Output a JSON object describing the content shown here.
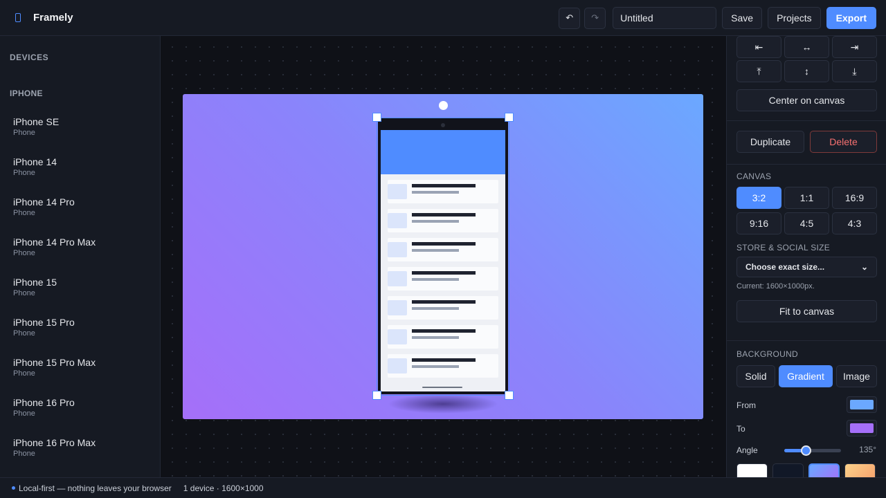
{
  "app": {
    "name": "Framely"
  },
  "toolbar": {
    "undo_icon": "↶",
    "redo_icon": "↷",
    "title_value": "Untitled",
    "save_label": "Save",
    "projects_label": "Projects",
    "export_label": "Export"
  },
  "sidebar": {
    "heading": "DEVICES",
    "group": "IPHONE",
    "devices": [
      {
        "name": "iPhone SE",
        "type": "Phone"
      },
      {
        "name": "iPhone 14",
        "type": "Phone"
      },
      {
        "name": "iPhone 14 Pro",
        "type": "Phone"
      },
      {
        "name": "iPhone 14 Pro Max",
        "type": "Phone"
      },
      {
        "name": "iPhone 15",
        "type": "Phone"
      },
      {
        "name": "iPhone 15 Pro",
        "type": "Phone"
      },
      {
        "name": "iPhone 15 Pro Max",
        "type": "Phone"
      },
      {
        "name": "iPhone 16 Pro",
        "type": "Phone"
      },
      {
        "name": "iPhone 16 Pro Max",
        "type": "Phone"
      }
    ]
  },
  "panel": {
    "align_row1": [
      "⇤",
      "↔",
      "⇥"
    ],
    "align_row2": [
      "⤒",
      "↕",
      "⤓"
    ],
    "center_label": "Center on canvas",
    "duplicate_label": "Duplicate",
    "delete_label": "Delete",
    "canvas_label": "CANVAS",
    "ratios": [
      "3:2",
      "1:1",
      "16:9",
      "9:16",
      "4:5",
      "4:3"
    ],
    "active_ratio": "3:2",
    "store_label": "STORE & SOCIAL SIZE",
    "size_select": "Choose exact size...",
    "current_note": "Current: 1600×1000px.",
    "fit_label": "Fit to canvas",
    "background_label": "BACKGROUND",
    "bg_tabs": [
      "Solid",
      "Gradient",
      "Image"
    ],
    "active_bg_tab": "Gradient",
    "from_label": "From",
    "to_label": "To",
    "angle_label": "Angle",
    "angle_value": "135°",
    "angle_degrees": 135,
    "from_color": "#6ba8ff",
    "to_color": "#a56ff9"
  },
  "status": {
    "privacy": "Local-first — nothing leaves your browser",
    "info": "1 device · 1600×1000"
  },
  "colors": {
    "accent": "#4f8cff",
    "delete": "#f87171"
  }
}
